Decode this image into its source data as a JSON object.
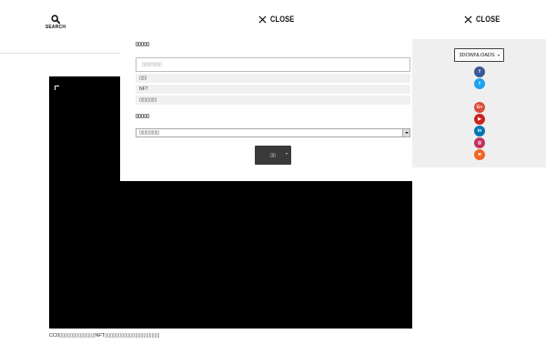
{
  "header": {
    "search_label": "SEARCH",
    "close_label": "CLOSE"
  },
  "hero": {
    "caption": "CC0▯▯▯▯▯▯▯▯▯▯▯▯▯NFT▯▯▯▯▯▯▯▯▯▯▯▯▯▯▯▯▯▯▯▯"
  },
  "search_panel": {
    "keyword_heading": "▯▯▯▯▯",
    "keyword_placeholder": "▯▯▯▯▯▯▯▯",
    "suggestions": [
      "▯▯▯",
      "NFT",
      "▯▯▯▯▯▯▯"
    ],
    "category_heading": "▯▯▯▯▯",
    "category_selected": "▯▯▯▯▯▯▯▯",
    "submit_label": "▯▯"
  },
  "share_panel": {
    "downloads_label": "3DOWNLOADS",
    "icons": [
      {
        "name": "facebook-icon",
        "glyph": "f",
        "color": "#3b5998"
      },
      {
        "name": "twitter-icon",
        "glyph": "t",
        "color": "#1da1f2"
      },
      {
        "name": "google-plus-icon",
        "glyph": "G+",
        "color": "#dd4b39"
      },
      {
        "name": "youtube-icon",
        "glyph": "▶",
        "color": "#cd201f"
      },
      {
        "name": "linkedin-icon",
        "glyph": "in",
        "color": "#0077b5"
      },
      {
        "name": "instagram-icon",
        "glyph": "◎",
        "color": "#c1335b"
      },
      {
        "name": "rss-icon",
        "glyph": "≋",
        "color": "#f26522"
      }
    ]
  }
}
